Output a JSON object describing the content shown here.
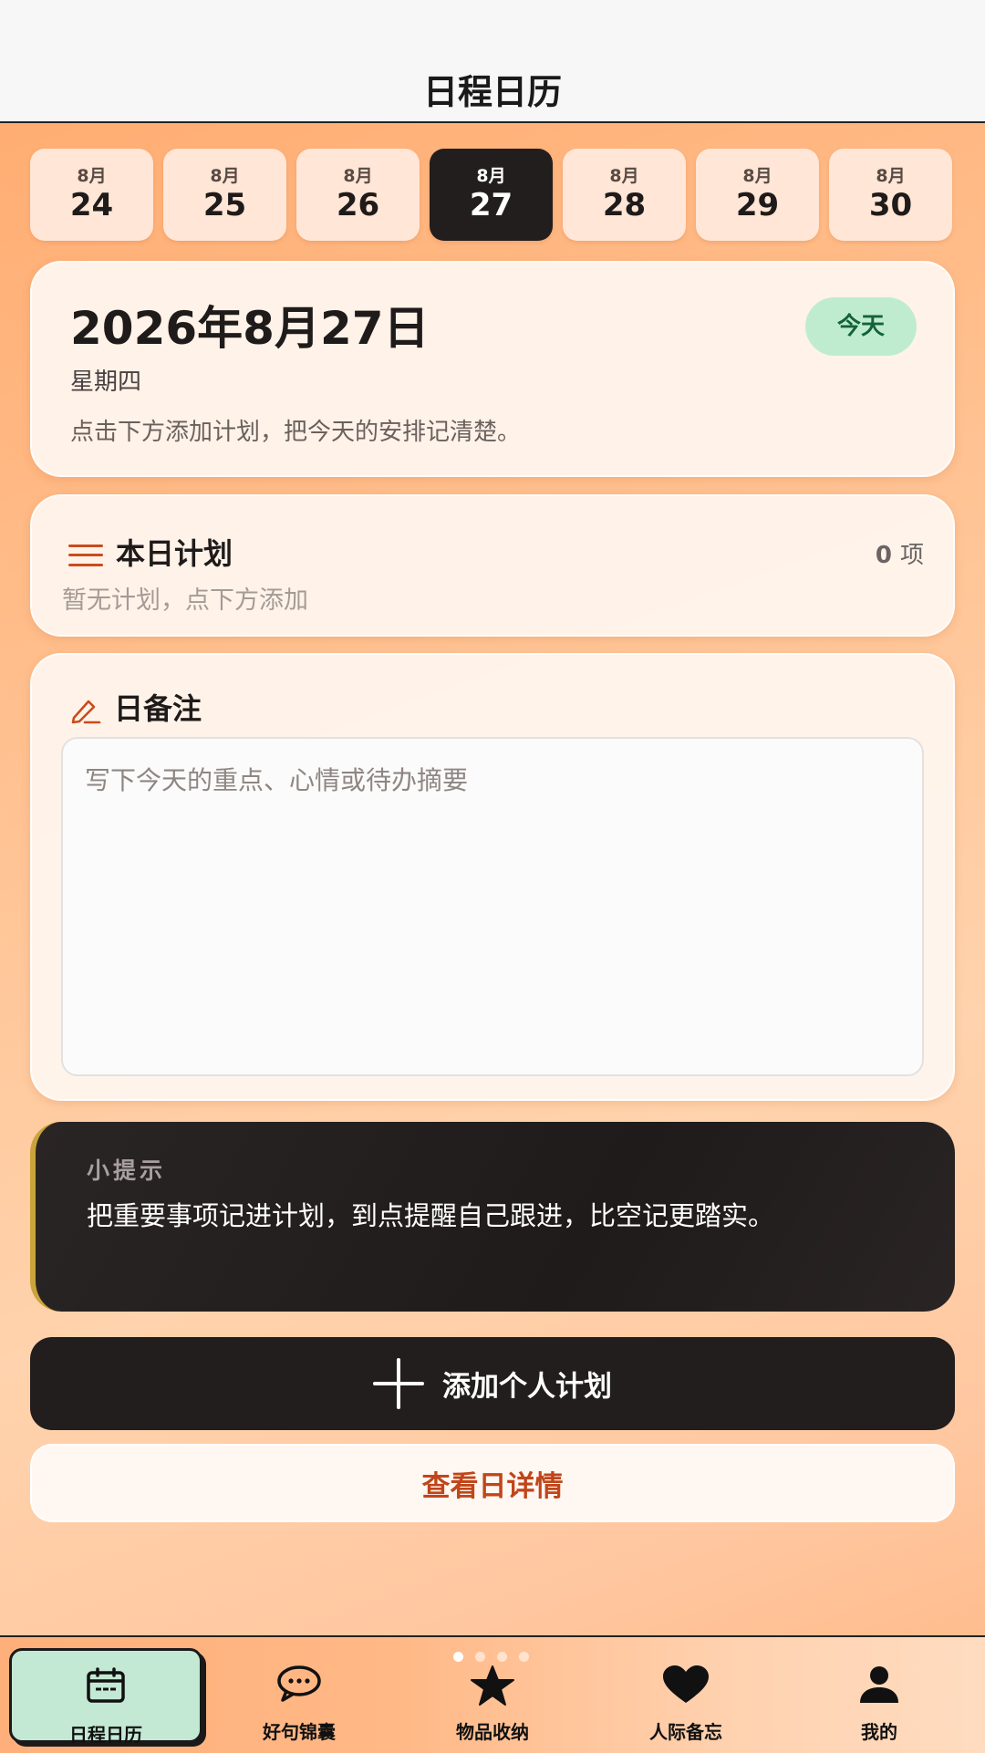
{
  "header": {
    "title": "日程日历"
  },
  "date_strip": [
    {
      "month": "8月",
      "day": "24",
      "active": false
    },
    {
      "month": "8月",
      "day": "25",
      "active": false
    },
    {
      "month": "8月",
      "day": "26",
      "active": false
    },
    {
      "month": "8月",
      "day": "27",
      "active": true
    },
    {
      "month": "8月",
      "day": "28",
      "active": false
    },
    {
      "month": "8月",
      "day": "29",
      "active": false
    },
    {
      "month": "8月",
      "day": "30",
      "active": false
    }
  ],
  "date_card": {
    "full_date": "2026年8月27日",
    "weekday": "星期四",
    "hint": "点击下方添加计划，把今天的安排记清楚。",
    "today_badge": "今天"
  },
  "plans": {
    "title": "本日计划",
    "count": "0",
    "count_unit": "项",
    "empty_text": "暂无计划，点下方添加"
  },
  "notes": {
    "title": "日备注",
    "placeholder": "写下今天的重点、心情或待办摘要",
    "value": ""
  },
  "tip": {
    "label": "小提示",
    "text": "把重要事项记进计划，到点提醒自己跟进，比空记更踏实。"
  },
  "buttons": {
    "add_plan": "添加个人计划",
    "view_detail": "查看日详情"
  },
  "tabbar": {
    "items": [
      {
        "label": "日程日历",
        "icon": "calendar-icon",
        "active": true
      },
      {
        "label": "好句锦囊",
        "icon": "chat-bubble-icon",
        "active": false
      },
      {
        "label": "物品收纳",
        "icon": "star-icon",
        "active": false
      },
      {
        "label": "人际备忘",
        "icon": "heart-icon",
        "active": false
      },
      {
        "label": "我的",
        "icon": "person-icon",
        "active": false
      }
    ],
    "page_indicator": {
      "count": 4,
      "current": 1
    }
  },
  "colors": {
    "accent_dark": "#221e1e",
    "accent_orange": "#c0461a",
    "today_badge_bg": "#bfeccf",
    "active_tab_bg": "#c3e8d4"
  }
}
